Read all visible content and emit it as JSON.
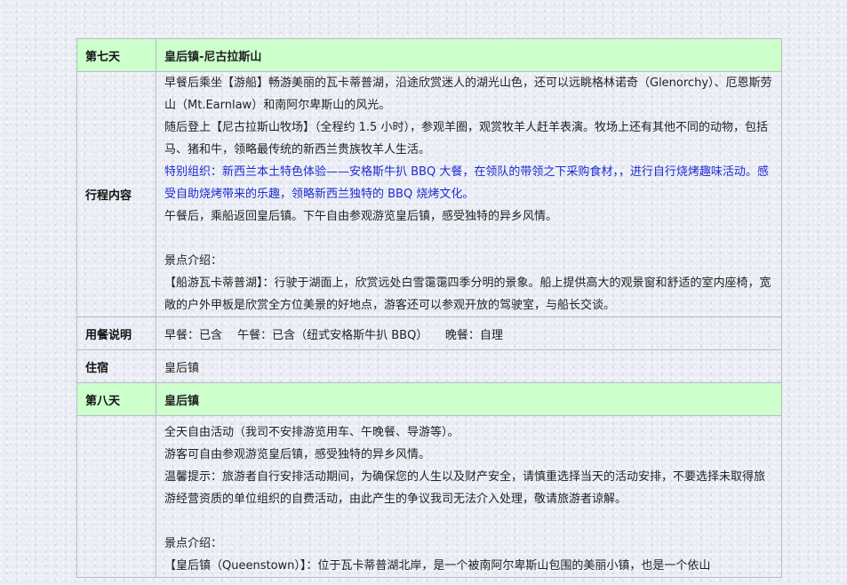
{
  "day7": {
    "label": "第七天",
    "title": "皇后镇-尼古拉斯山",
    "content_label": "行程内容",
    "paragraphs": [
      "早餐后乘坐【游船】畅游美丽的瓦卡蒂普湖，沿途欣赏迷人的湖光山色，还可以远眺格林诺奇（Glenorchy）、厄恩斯劳山（Mt.Earnlaw）和南阿尔卑斯山的风光。",
      "随后登上【尼古拉斯山牧场】（全程约 1.5 小时），参观羊圈，观赏牧羊人赶羊表演。牧场上还有其他不同的动物，包括马、猪和牛，领略最传统的新西兰贵族牧羊人生活。",
      "特别组织：新西兰本土特色体验——安格斯牛扒 BBQ 大餐，在领队的带领之下采购食材，，进行自行烧烤趣味活动。感受自助烧烤带来的乐趣，领略新西兰独特的 BBQ 烧烤文化。",
      "午餐后，乘船返回皇后镇。下午自由参观游览皇后镇，感受独特的异乡风情。"
    ],
    "attraction_heading": "景点介绍：",
    "attraction_text": "【船游瓦卡蒂普湖】：行驶于湖面上，欣赏远处白雪霭霭四季分明的景象。船上提供高大的观景窗和舒适的室内座椅，宽敞的户外甲板是欣赏全方位美景的好地点，游客还可以参观开放的驾驶室，与船长交谈。",
    "meal_label": "用餐说明",
    "meal_text": "早餐：已含　 午餐：已含（纽式安格斯牛扒 BBQ）　　晚餐：自理",
    "lodging_label": "住宿",
    "lodging_text": "皇后镇"
  },
  "day8": {
    "label": "第八天",
    "title": "皇后镇",
    "paragraphs": [
      "全天自由活动（我司不安排游览用车、午晚餐、导游等）。",
      "游客可自由参观游览皇后镇，感受独特的异乡风情。",
      "温馨提示：旅游者自行安排活动期间，为确保您的人生以及财产安全，请慎重选择当天的活动安排，不要选择未取得旅游经营资质的单位组织的自费活动，由此产生的争议我司无法介入处理，敬请旅游者谅解。"
    ],
    "attraction_heading": "景点介绍：",
    "attraction_text": "【皇后镇（Queenstown）】：位于瓦卡蒂普湖北岸，是一个被南阿尔卑斯山包围的美丽小镇，也是一个依山"
  },
  "colors": {
    "header_bg": "#ccffcc",
    "highlight_text": "#1d2bd0",
    "border": "#b9bcc8"
  }
}
